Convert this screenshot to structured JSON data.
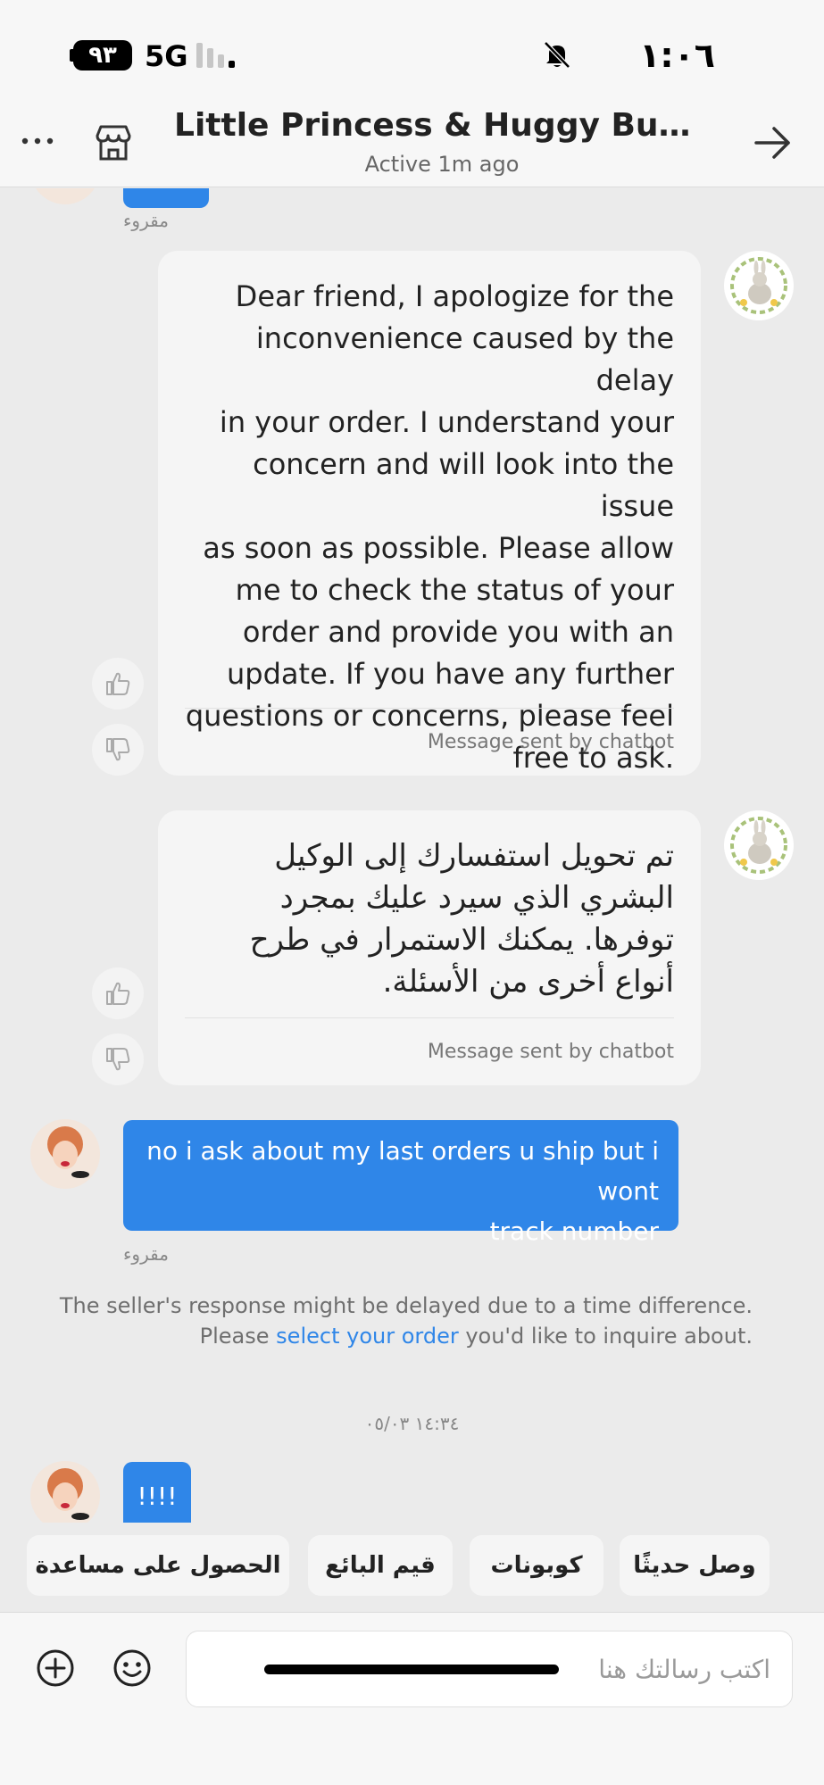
{
  "status_bar": {
    "battery": "٩٣",
    "network": "5G",
    "time": "١:٠٦"
  },
  "header": {
    "title": "Little Princess & Huggy Bunny S...",
    "subtitle": "Active 1m ago"
  },
  "messages": {
    "top_read_label": "مقروء",
    "bot_1": {
      "lines": [
        "Dear friend, I apologize for the",
        "inconvenience caused by the delay",
        "in your order. I understand your",
        "concern and will look into the issue",
        "as soon as possible. Please allow",
        "me to check the status of your",
        "order and provide you with an",
        "update. If you have any further",
        "questions or concerns, please feel",
        "free to ask."
      ],
      "footer": "Message sent by chatbot"
    },
    "bot_2": {
      "lines": [
        "تم تحويل استفسارك إلى الوكيل",
        "البشري الذي سيرد عليك بمجرد",
        "توفرها. يمكنك الاستمرار في طرح",
        "أنواع أخرى من الأسئلة."
      ],
      "footer": "Message sent by chatbot"
    },
    "user_1": {
      "lines": [
        "no i ask about my last orders u ship but i wont",
        "track number"
      ],
      "read_label": "مقروء"
    },
    "notice": {
      "text_1": "The seller's response might be delayed due to a time difference. Please",
      "link": "select your order",
      "text_2": " you'd like to inquire about."
    },
    "date_separator": "١٤:٣٤ ٠٥/٠٣",
    "user_2": {
      "text": "!!!!"
    }
  },
  "quick_replies": [
    "وصل حديثًا",
    "كوبونات",
    "قيم البائع",
    "الحصول على مساعدة"
  ],
  "input": {
    "placeholder": "اكتب رسالتك هنا"
  },
  "icons": {
    "more": "more-icon",
    "store": "store-icon",
    "back": "back-arrow-icon",
    "like": "thumbs-up-icon",
    "dislike": "thumbs-down-icon",
    "plus": "plus-icon",
    "emoji": "emoji-icon",
    "muted": "bell-slash-icon"
  },
  "colors": {
    "accent_blue": "#2f86e8",
    "chat_background": "#ebebeb",
    "bot_bubble": "#f5f5f5"
  }
}
